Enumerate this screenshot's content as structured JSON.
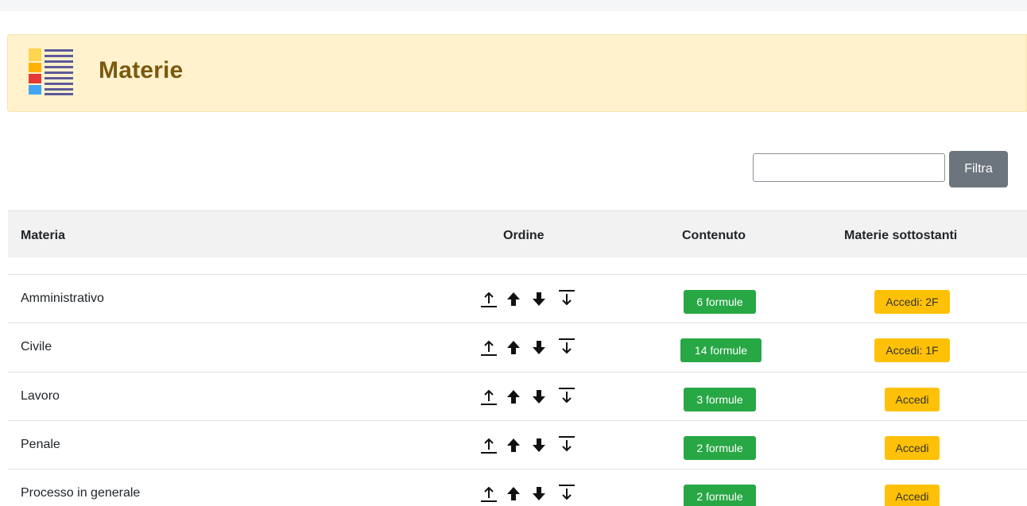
{
  "header": {
    "title": "Materie",
    "icon": "list-icon"
  },
  "filter": {
    "input_value": "",
    "input_placeholder": "",
    "button_label": "Filtra"
  },
  "table": {
    "columns": [
      "Materia",
      "Ordine",
      "Contenuto",
      "Materie sottostanti"
    ],
    "rows": [
      {
        "name": "Amministrativo",
        "contenuto": "6 formule",
        "sottostanti": "Accedi: 2F"
      },
      {
        "name": "Civile",
        "contenuto": "14 formule",
        "sottostanti": "Accedi: 1F"
      },
      {
        "name": "Lavoro",
        "contenuto": "3 formule",
        "sottostanti": "Accedi"
      },
      {
        "name": "Penale",
        "contenuto": "2 formule",
        "sottostanti": "Accedi"
      },
      {
        "name": "Processo in generale",
        "contenuto": "2 formule",
        "sottostanti": "Accedi"
      }
    ]
  },
  "colors": {
    "header_bg": "#fff2cc",
    "title": "#7a5a10",
    "success": "#28a745",
    "warning": "#ffc107",
    "secondary": "#6c757d"
  },
  "order_icons": [
    "move-top-icon",
    "move-up-icon",
    "move-down-icon",
    "move-bottom-icon"
  ]
}
